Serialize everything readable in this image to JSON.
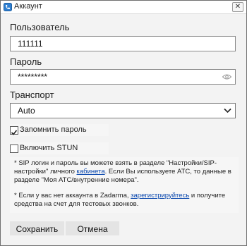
{
  "window": {
    "title": "Аккаунт",
    "close_glyph": "✕"
  },
  "form": {
    "username_label": "Пользователь",
    "username_value": "111111",
    "password_label": "Пароль",
    "password_value": "*********",
    "transport_label": "Транспорт",
    "transport_value": "Auto",
    "remember_password_label": "Запомнить пароль",
    "remember_password_checked": true,
    "stun_label": "Включить STUN",
    "stun_checked": false
  },
  "notes": {
    "sip": {
      "before": "* SIP логин и пароль вы можете взять в разделе \"Настройки/SIP-настройки\" личного ",
      "link": "кабинета",
      "after": ". Если Вы используете АТС, то данные в разделе \"Моя АТС/внутренние номера\"."
    },
    "register": {
      "before": "* Если у вас нет аккаунта в Zadarma, ",
      "link": "зарегистрируйтесь",
      "after": " и получите средства на счет для тестовых звонков."
    }
  },
  "buttons": {
    "save": "Сохранить",
    "cancel": "Отмена"
  },
  "icons": {
    "app": "phone-app-icon",
    "password_reveal": "eye-icon",
    "dropdown": "chevron-down-icon"
  },
  "colors": {
    "link": "#0645ad",
    "window_border": "#707070"
  }
}
